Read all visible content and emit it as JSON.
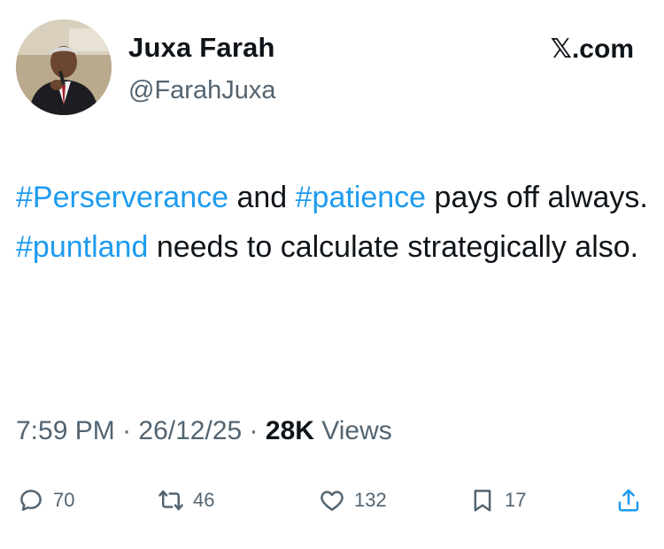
{
  "tweet": {
    "author_name": "Juxa Farah",
    "author_handle": "@FarahJuxa",
    "brand": "X.com",
    "brand_mark": "𝕏",
    "brand_suffix": ".com",
    "text": {
      "tag1": "#Perserverance",
      "t1": " and ",
      "tag2": "#patience",
      "t2": " pays off always.",
      "tag3": "#puntland",
      "t3": " needs to calculate strategically also."
    },
    "time": "7:59 PM",
    "date": "26/12/25",
    "separator": "·",
    "views_count": "28K",
    "views_label": "Views"
  },
  "actions": {
    "replies": "70",
    "reposts": "46",
    "likes": "132",
    "bookmarks": "17"
  },
  "colors": {
    "hashtag": "#1d9bf0",
    "secondary_text": "#536471",
    "primary_text": "#0f1419"
  },
  "icons": [
    "reply-icon",
    "repost-icon",
    "like-icon",
    "bookmark-icon",
    "share-icon"
  ]
}
